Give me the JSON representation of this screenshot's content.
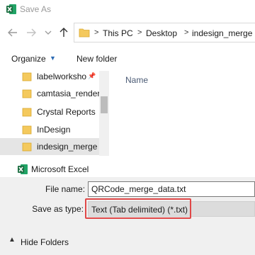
{
  "window": {
    "title": "Save As",
    "icon": "excel-icon"
  },
  "address_bar": {
    "crumbs": [
      "This PC",
      "Desktop",
      "indesign_merge"
    ],
    "separator": ">"
  },
  "toolbar": {
    "organize_label": "Organize",
    "new_folder_label": "New folder"
  },
  "nav_pane": {
    "items": [
      {
        "label": "labelworksho",
        "pinned": true
      },
      {
        "label": "camtasia_render"
      },
      {
        "label": "Crystal Reports"
      },
      {
        "label": "InDesign"
      },
      {
        "label": "indesign_merge",
        "selected": true
      }
    ],
    "app_item": {
      "label": "Microsoft Excel"
    }
  },
  "file_list": {
    "column_name": "Name"
  },
  "form": {
    "file_name_label": "File name:",
    "file_name_value": "QRCode_merge_data.txt",
    "save_type_label": "Save as type:",
    "save_type_value": "Text (Tab delimited) (*.txt)"
  },
  "footer": {
    "hide_folders_label": "Hide Folders"
  },
  "colors": {
    "accent": "#2c6ab3",
    "highlight": "#e04848",
    "folder": "#f4c95d",
    "excel": "#1d6f42"
  }
}
